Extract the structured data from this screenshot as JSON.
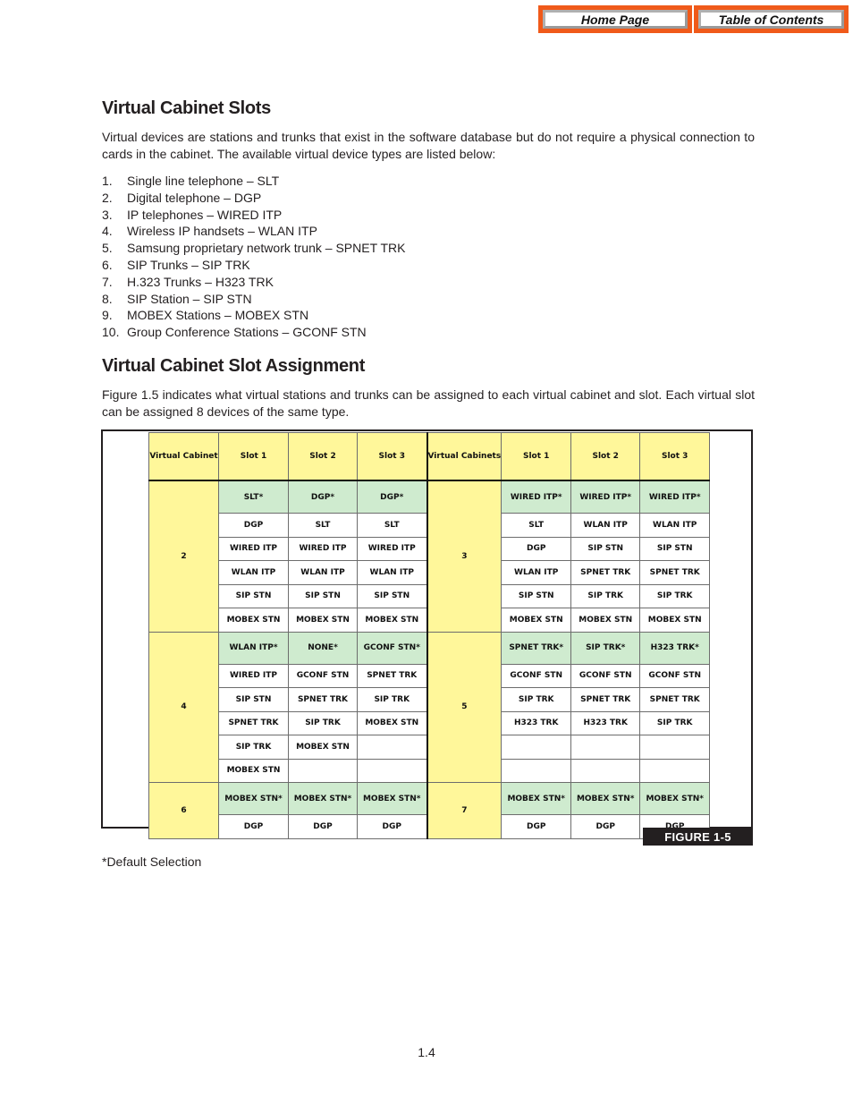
{
  "nav": {
    "home_label": "Home Page",
    "toc_label": "Table of Contents",
    "accent_color": "#f05a1a"
  },
  "section1": {
    "title": "Virtual Cabinet Slots",
    "intro": "Virtual devices are stations and trunks that exist in the software database but do not require a physical connection to cards in the cabinet.  The available virtual device types are listed below:",
    "items": [
      {
        "num": "1.",
        "text": "Single line telephone – SLT"
      },
      {
        "num": "2.",
        "text": "Digital telephone – DGP"
      },
      {
        "num": "3.",
        "text": "IP telephones – WIRED ITP"
      },
      {
        "num": "4.",
        "text": "Wireless IP handsets – WLAN ITP"
      },
      {
        "num": "5.",
        "text": "Samsung proprietary network trunk – SPNET TRK"
      },
      {
        "num": "6.",
        "text": "SIP Trunks – SIP TRK"
      },
      {
        "num": "7.",
        "text": "H.323 Trunks – H323 TRK"
      },
      {
        "num": "8.",
        "text": "SIP Station – SIP STN"
      },
      {
        "num": "9.",
        "text": "MOBEX Stations – MOBEX STN"
      },
      {
        "num": "10.",
        "text": "Group Conference Stations – GCONF STN"
      }
    ]
  },
  "section2": {
    "title": "Virtual Cabinet Slot Assignment",
    "intro": "Figure 1.5 indicates what virtual stations and trunks can be assigned to each virtual cabinet and slot. Each virtual slot can be assigned 8 devices of the same type."
  },
  "figure": {
    "label": "FIGURE 1-5",
    "colors": {
      "header": "#fff79a",
      "default": "#cfebcf"
    },
    "left_header": {
      "cabinet": "Virtual Cabinet",
      "slot1": "Slot 1",
      "slot2": "Slot 2",
      "slot3": "Slot 3"
    },
    "right_header": {
      "cabinet": "Virtual Cabinets",
      "slot1": "Slot 1",
      "slot2": "Slot 2",
      "slot3": "Slot 3"
    },
    "blocks": [
      {
        "left": {
          "cabinet": "2",
          "rows": [
            [
              "SLT*",
              "DGP*",
              "DGP*"
            ],
            [
              "DGP",
              "SLT",
              "SLT"
            ],
            [
              "WIRED ITP",
              "WIRED ITP",
              "WIRED ITP"
            ],
            [
              "WLAN ITP",
              "WLAN ITP",
              "WLAN ITP"
            ],
            [
              "SIP STN",
              "SIP STN",
              "SIP STN"
            ],
            [
              "MOBEX STN",
              "MOBEX STN",
              "MOBEX STN"
            ]
          ]
        },
        "right": {
          "cabinet": "3",
          "rows": [
            [
              "WIRED ITP*",
              "WIRED ITP*",
              "WIRED ITP*"
            ],
            [
              "SLT",
              "WLAN ITP",
              "WLAN ITP"
            ],
            [
              "DGP",
              "SIP STN",
              "SIP STN"
            ],
            [
              "WLAN ITP",
              "SPNET TRK",
              "SPNET TRK"
            ],
            [
              "SIP STN",
              "SIP TRK",
              "SIP TRK"
            ],
            [
              "MOBEX STN",
              "MOBEX STN",
              "MOBEX STN"
            ]
          ]
        }
      },
      {
        "left": {
          "cabinet": "4",
          "rows": [
            [
              "WLAN ITP*",
              "NONE*",
              "GCONF STN*"
            ],
            [
              "WIRED ITP",
              "GCONF STN",
              "SPNET TRK"
            ],
            [
              "SIP STN",
              "SPNET TRK",
              "SIP TRK"
            ],
            [
              "SPNET TRK",
              "SIP TRK",
              "MOBEX STN"
            ],
            [
              "SIP TRK",
              "MOBEX STN",
              ""
            ],
            [
              "MOBEX STN",
              "",
              ""
            ]
          ]
        },
        "right": {
          "cabinet": "5",
          "rows": [
            [
              "SPNET TRK*",
              "SIP TRK*",
              "H323 TRK*"
            ],
            [
              "GCONF STN",
              "GCONF STN",
              "GCONF STN"
            ],
            [
              "SIP TRK",
              "SPNET TRK",
              "SPNET TRK"
            ],
            [
              "H323 TRK",
              "H323 TRK",
              "SIP TRK"
            ],
            [
              "",
              "",
              ""
            ],
            [
              "",
              "",
              ""
            ]
          ]
        }
      },
      {
        "left": {
          "cabinet": "6",
          "rows": [
            [
              "MOBEX STN*",
              "MOBEX STN*",
              "MOBEX STN*"
            ],
            [
              "DGP",
              "DGP",
              "DGP"
            ]
          ]
        },
        "right": {
          "cabinet": "7",
          "rows": [
            [
              "MOBEX STN*",
              "MOBEX STN*",
              "MOBEX STN*"
            ],
            [
              "DGP",
              "DGP",
              "DGP"
            ]
          ]
        }
      }
    ]
  },
  "footnote": "*Default Selection",
  "page_number": "1.4"
}
